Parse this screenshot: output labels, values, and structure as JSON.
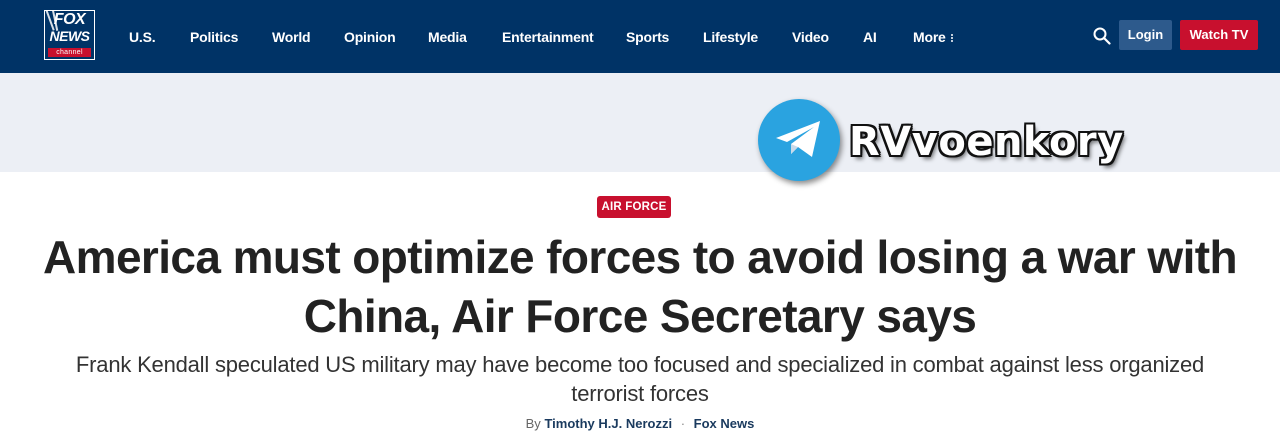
{
  "header": {
    "logo": {
      "line1": "FOX",
      "line2": "NEWS",
      "line3": "channel"
    },
    "nav": [
      "U.S.",
      "Politics",
      "World",
      "Opinion",
      "Media",
      "Entertainment",
      "Sports",
      "Lifestyle",
      "Video",
      "AI",
      "More"
    ],
    "login_label": "Login",
    "watch_label": "Watch TV",
    "colors": {
      "bar": "#003366",
      "watch": "#c8102e",
      "login": "#2d5a8c"
    }
  },
  "watermark": {
    "text": "RVvoenkory",
    "icon": "telegram-icon"
  },
  "article": {
    "category": "AIR FORCE",
    "headline_line1": "America must optimize forces to avoid losing a war with",
    "headline_line2": "China, Air Force Secretary says",
    "subhead_line1": "Frank Kendall speculated US military may have become too focused and specialized in combat against less organized",
    "subhead_line2": "terrorist forces",
    "byline_prefix": "By",
    "author": "Timothy H.J. Nerozzi",
    "separator": "·",
    "source": "Fox News"
  }
}
